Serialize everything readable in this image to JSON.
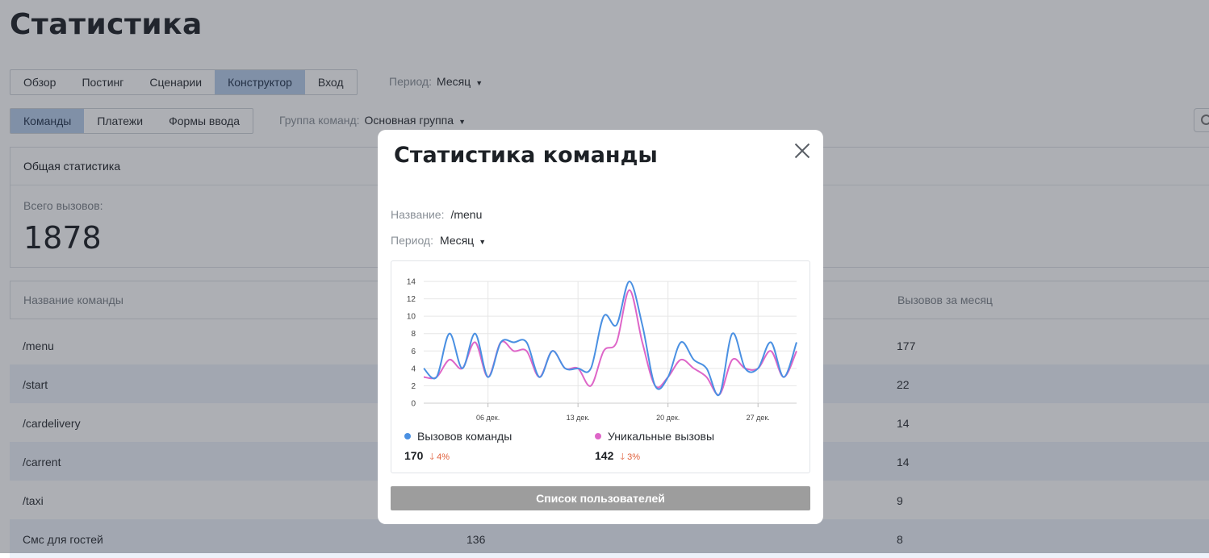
{
  "page": {
    "title": "Статистика",
    "main_tabs": [
      {
        "label": "Обзор",
        "active": false
      },
      {
        "label": "Постинг",
        "active": false
      },
      {
        "label": "Сценарии",
        "active": false
      },
      {
        "label": "Конструктор",
        "active": true
      },
      {
        "label": "Вход",
        "active": false
      }
    ],
    "period": {
      "label": "Период:",
      "value": "Месяц"
    },
    "sub_tabs": [
      {
        "label": "Команды",
        "active": true
      },
      {
        "label": "Платежи",
        "active": false
      },
      {
        "label": "Формы ввода",
        "active": false
      }
    ],
    "command_group": {
      "label": "Группа команд:",
      "value": "Основная группа"
    },
    "general": {
      "header": "Общая статистика",
      "total_label": "Всего вызовов:",
      "total_value": "1878"
    },
    "table": {
      "col_name": "Название команды",
      "col_month": "Вызовов за месяц",
      "rows": [
        {
          "name": "/menu",
          "mid": "",
          "month": "177"
        },
        {
          "name": "/start",
          "mid": "",
          "month": "22"
        },
        {
          "name": "/cardelivery",
          "mid": "",
          "month": "14"
        },
        {
          "name": "/carrent",
          "mid": "",
          "month": "14"
        },
        {
          "name": "/taxi",
          "mid": "",
          "month": "9"
        },
        {
          "name": "Смс для гостей",
          "mid": "136",
          "month": "8"
        }
      ]
    }
  },
  "modal": {
    "title": "Статистика команды",
    "name_label": "Название:",
    "name_value": "/menu",
    "period_label": "Период:",
    "period_value": "Месяц",
    "legend": [
      {
        "name": "Вызовов команды",
        "color": "#4a90e2",
        "total": "170",
        "delta": "4%"
      },
      {
        "name": "Уникальные вызовы",
        "color": "#de66c8",
        "total": "142",
        "delta": "3%"
      }
    ],
    "users_button": "Список пользователей"
  },
  "chart_data": {
    "type": "line",
    "x_ticks": [
      "06 дек.",
      "13 дек.",
      "20 дек.",
      "27 дек."
    ],
    "y_ticks": [
      "0",
      "2",
      "4",
      "6",
      "8",
      "10",
      "12",
      "14"
    ],
    "ylim": [
      0,
      14
    ],
    "x_range_days": [
      1,
      30
    ],
    "x_dates": [
      "1 дек.",
      "30 дек."
    ],
    "grid": true,
    "series": [
      {
        "name": "Вызовов команды",
        "color": "#4a90e2",
        "values": [
          4,
          3,
          8,
          4,
          8,
          3,
          7,
          7,
          7,
          3,
          6,
          4,
          4,
          4,
          10,
          9,
          14,
          9,
          2,
          3,
          7,
          5,
          4,
          1,
          8,
          4,
          4,
          7,
          3,
          7
        ]
      },
      {
        "name": "Уникальные вызовы",
        "color": "#de66c8",
        "values": [
          3,
          3,
          5,
          4,
          7,
          3,
          7,
          6,
          6,
          3,
          6,
          4,
          4,
          2,
          6,
          7,
          13,
          7,
          2,
          3,
          5,
          4,
          3,
          1,
          5,
          4,
          4,
          6,
          3,
          6
        ]
      }
    ]
  }
}
